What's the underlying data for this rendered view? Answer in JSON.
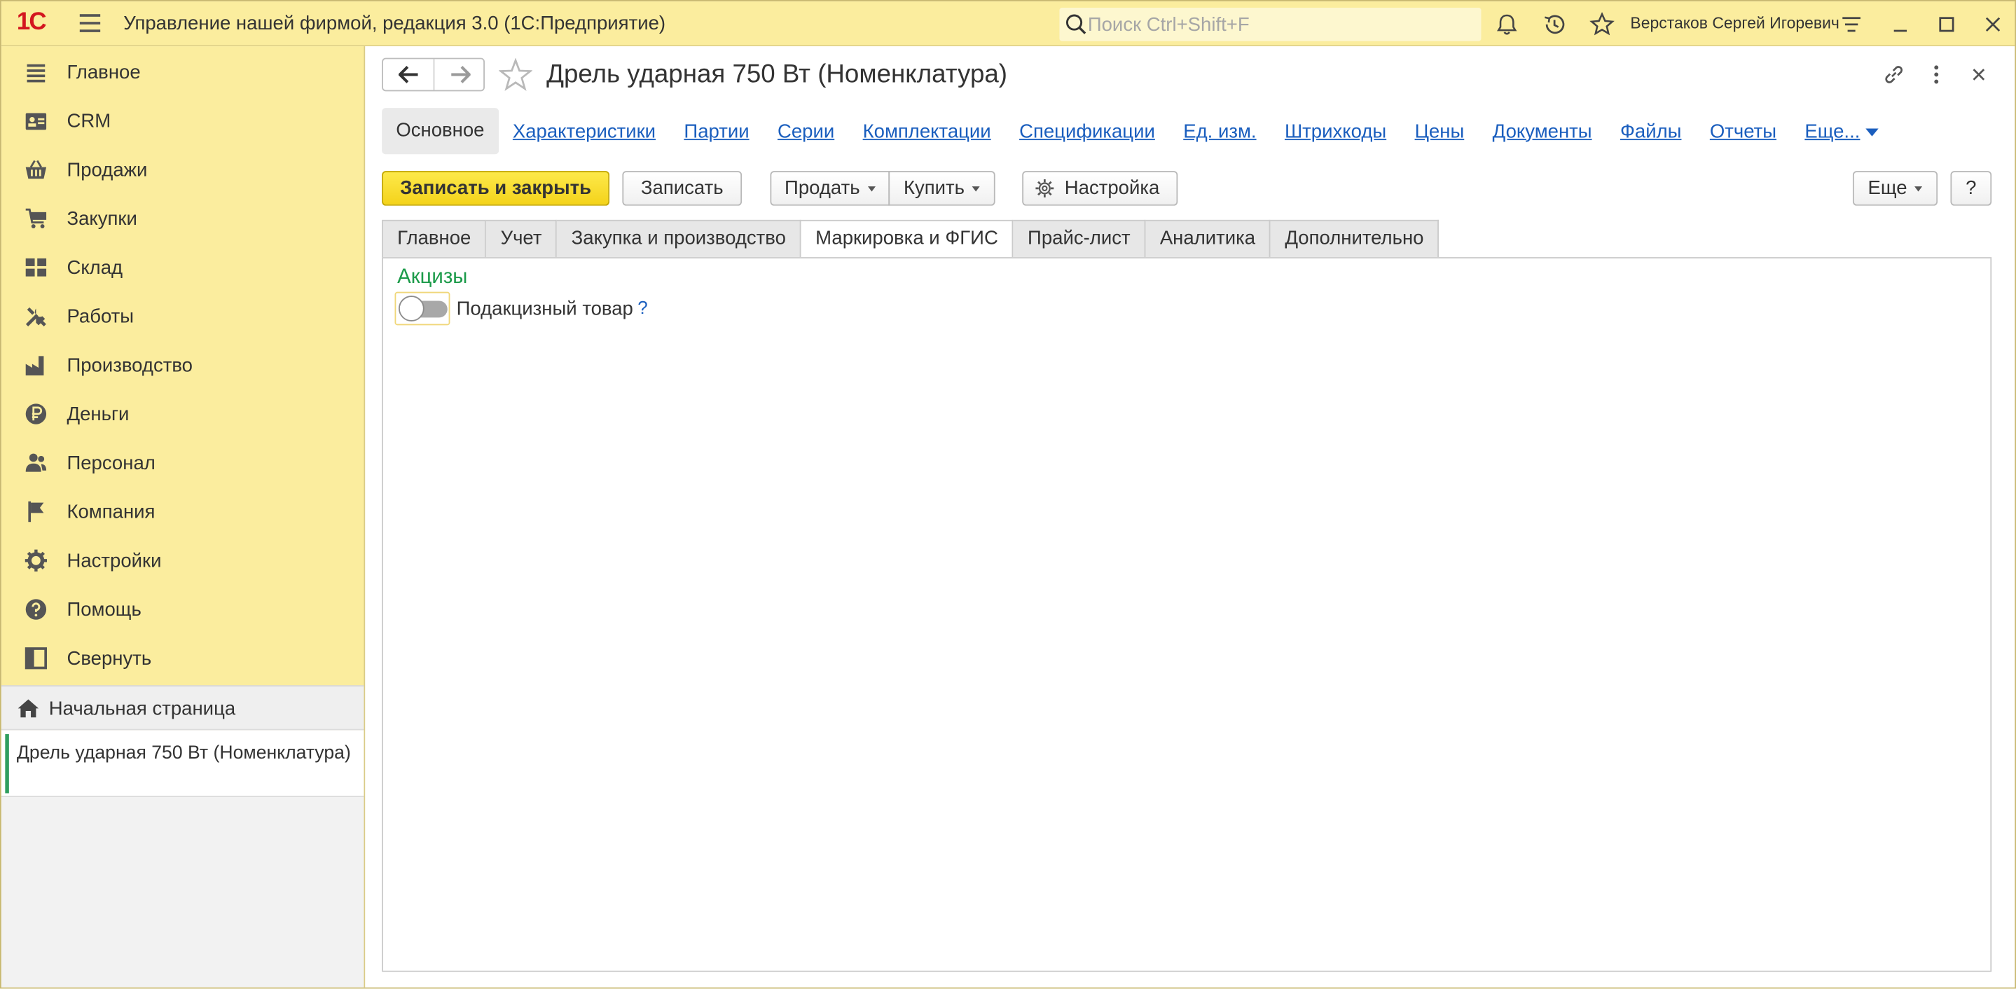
{
  "titlebar": {
    "logo_text": "1С",
    "app_title": "Управление нашей фирмой, редакция 3.0  (1С:Предприятие)",
    "search_placeholder": "Поиск Ctrl+Shift+F",
    "user_name": "Верстаков Сергей Игоревич"
  },
  "sidebar": {
    "items": [
      {
        "label": "Главное",
        "icon": "list-icon"
      },
      {
        "label": "CRM",
        "icon": "contacts-icon"
      },
      {
        "label": "Продажи",
        "icon": "basket-icon"
      },
      {
        "label": "Закупки",
        "icon": "cart-icon"
      },
      {
        "label": "Склад",
        "icon": "warehouse-icon"
      },
      {
        "label": "Работы",
        "icon": "tools-icon"
      },
      {
        "label": "Производство",
        "icon": "factory-icon"
      },
      {
        "label": "Деньги",
        "icon": "ruble-icon"
      },
      {
        "label": "Персонал",
        "icon": "people-icon"
      },
      {
        "label": "Компания",
        "icon": "flag-icon"
      },
      {
        "label": "Настройки",
        "icon": "gear-icon"
      },
      {
        "label": "Помощь",
        "icon": "help-icon"
      },
      {
        "label": "Свернуть",
        "icon": "collapse-icon"
      }
    ],
    "home_label": "Начальная страница",
    "open_window_label": "Дрель ударная 750 Вт (Номенклатура)"
  },
  "form": {
    "title": "Дрель ударная 750 Вт (Номенклатура)",
    "links": {
      "active": "Основное",
      "items": [
        "Характеристики",
        "Партии",
        "Серии",
        "Комплектации",
        "Спецификации",
        "Ед. изм.",
        "Штрихкоды",
        "Цены",
        "Документы",
        "Файлы",
        "Отчеты"
      ],
      "more": "Еще..."
    },
    "toolbar": {
      "save_close": "Записать и закрыть",
      "save": "Записать",
      "sell": "Продать",
      "buy": "Купить",
      "settings": "Настройка",
      "more": "Еще",
      "help": "?"
    },
    "tabs": [
      "Главное",
      "Учет",
      "Закупка и производство",
      "Маркировка и ФГИС",
      "Прайс-лист",
      "Аналитика",
      "Дополнительно"
    ],
    "active_tab": "Маркировка и ФГИС",
    "section": {
      "title": "Акцизы",
      "toggle_label": "Подакцизный товар",
      "toggle_on": false,
      "help": "?"
    }
  },
  "colors": {
    "accent_yellow": "#fbed9e",
    "primary_button": "#f4d31b",
    "link": "#1a5ebe",
    "section_green": "#1c9b4a",
    "logo_red": "#d3161f"
  }
}
